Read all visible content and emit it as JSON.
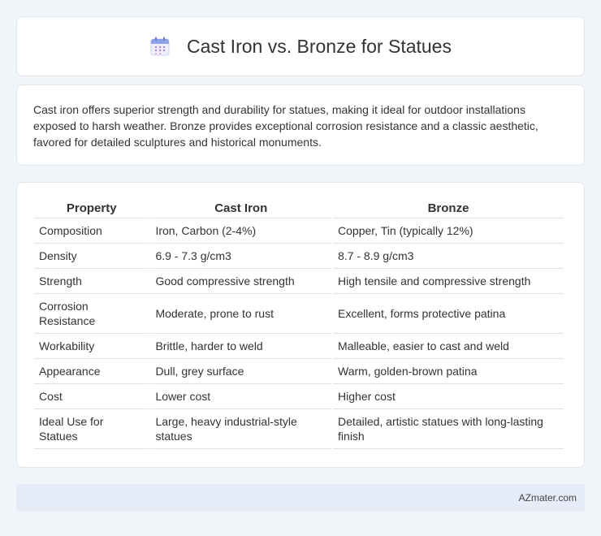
{
  "header": {
    "title": "Cast Iron vs. Bronze for Statues",
    "icon": "calendar-icon"
  },
  "intro": {
    "text": "Cast iron offers superior strength and durability for statues, making it ideal for outdoor installations exposed to harsh weather. Bronze provides exceptional corrosion resistance and a classic aesthetic, favored for detailed sculptures and historical monuments."
  },
  "table": {
    "headers": [
      "Property",
      "Cast Iron",
      "Bronze"
    ],
    "rows": [
      [
        "Composition",
        "Iron, Carbon (2-4%)",
        "Copper, Tin (typically 12%)"
      ],
      [
        "Density",
        "6.9 - 7.3 g/cm3",
        "8.7 - 8.9 g/cm3"
      ],
      [
        "Strength",
        "Good compressive strength",
        "High tensile and compressive strength"
      ],
      [
        "Corrosion Resistance",
        "Moderate, prone to rust",
        "Excellent, forms protective patina"
      ],
      [
        "Workability",
        "Brittle, harder to weld",
        "Malleable, easier to cast and weld"
      ],
      [
        "Appearance",
        "Dull, grey surface",
        "Warm, golden-brown patina"
      ],
      [
        "Cost",
        "Lower cost",
        "Higher cost"
      ],
      [
        "Ideal Use for Statues",
        "Large, heavy industrial-style statues",
        "Detailed, artistic statues with long-lasting finish"
      ]
    ]
  },
  "footer": {
    "brand": "AZmater.com"
  },
  "colors": {
    "background": "#f1f4f9",
    "card": "#ffffff",
    "footer": "#e6ecf7",
    "icon_accent": "#7b8fd9"
  }
}
